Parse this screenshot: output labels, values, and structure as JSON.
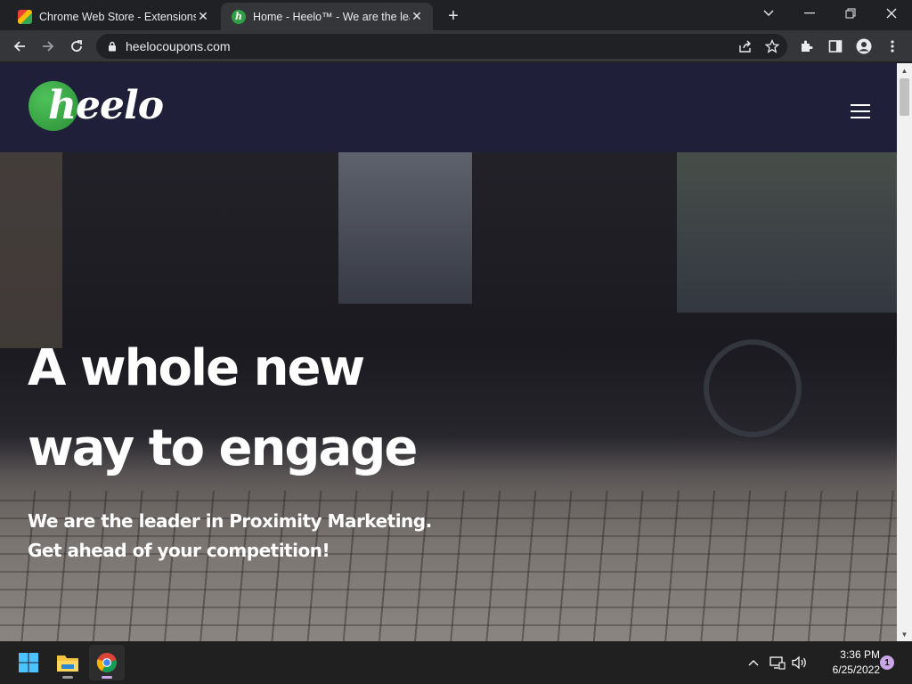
{
  "browser": {
    "tabs": [
      {
        "title": "Chrome Web Store - Extensions",
        "active": false,
        "favicon": "chrome-web-store-icon"
      },
      {
        "title": "Home - Heelo™ - We are the lead",
        "active": true,
        "favicon": "heelo-favicon"
      }
    ],
    "favicon_letter": "h",
    "url": "heelocoupons.com"
  },
  "site": {
    "logo_text": "heelo",
    "hero": {
      "title_line1": "A whole new",
      "title_line2": "way to engage",
      "subtitle_line1": "We are the leader in Proximity Marketing.",
      "subtitle_line2": "Get ahead of your competition!"
    }
  },
  "taskbar": {
    "apps": [
      "start-icon",
      "file-explorer-icon",
      "chrome-icon"
    ],
    "time": "3:36 PM",
    "date": "6/25/2022",
    "notification_count": "1"
  },
  "colors": {
    "header_bg": "#1f1f3a",
    "logo_green": "#2f9e44",
    "browser_dark": "#202124",
    "toolbar": "#35363a"
  }
}
